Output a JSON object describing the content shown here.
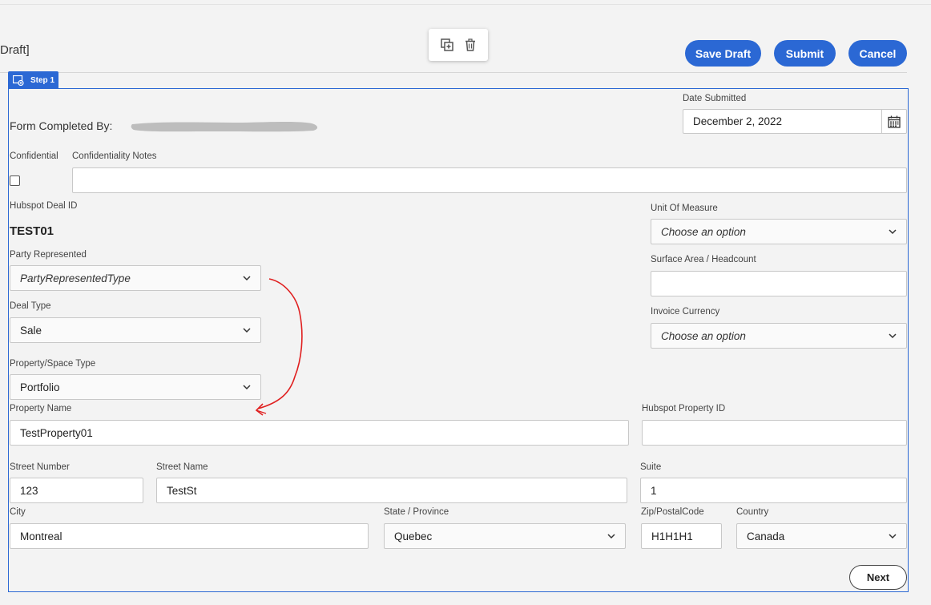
{
  "header": {
    "title_fragment": "Draft]",
    "buttons": {
      "save_draft": "Save Draft",
      "submit": "Submit",
      "cancel": "Cancel"
    },
    "icons": [
      "copy-add-icon",
      "trash-icon"
    ]
  },
  "step": {
    "label": "Step 1"
  },
  "form": {
    "form_completed_by_label": "Form Completed By:",
    "date_submitted": {
      "label": "Date Submitted",
      "value": "December 2, 2022"
    },
    "confidential": {
      "label": "Confidential",
      "checked": false
    },
    "confidentiality_notes": {
      "label": "Confidentiality Notes",
      "value": ""
    },
    "hubspot_deal_id": {
      "label": "Hubspot Deal ID",
      "value": "TEST01"
    },
    "unit_of_measure": {
      "label": "Unit Of Measure",
      "value": "Choose an option"
    },
    "party_represented": {
      "label": "Party Represented",
      "value": "PartyRepresentedType"
    },
    "surface_area": {
      "label": "Surface Area / Headcount",
      "value": ""
    },
    "deal_type": {
      "label": "Deal Type",
      "value": "Sale"
    },
    "invoice_currency": {
      "label": "Invoice Currency",
      "value": "Choose an option"
    },
    "property_space_type": {
      "label": "Property/Space Type",
      "value": "Portfolio"
    },
    "property_name": {
      "label": "Property Name",
      "value": "TestProperty01"
    },
    "hubspot_property_id": {
      "label": "Hubspot Property ID",
      "value": ""
    },
    "street_number": {
      "label": "Street Number",
      "value": "123"
    },
    "street_name": {
      "label": "Street Name",
      "value": "TestSt"
    },
    "suite": {
      "label": "Suite",
      "value": "1"
    },
    "city": {
      "label": "City",
      "value": "Montreal"
    },
    "state_province": {
      "label": "State / Province",
      "value": "Quebec"
    },
    "zip": {
      "label": "Zip/PostalCode",
      "value": "H1H1H1"
    },
    "country": {
      "label": "Country",
      "value": "Canada"
    }
  },
  "footer": {
    "next": "Next"
  },
  "colors": {
    "accent": "#2b68d4",
    "annotation": "#e02020"
  }
}
